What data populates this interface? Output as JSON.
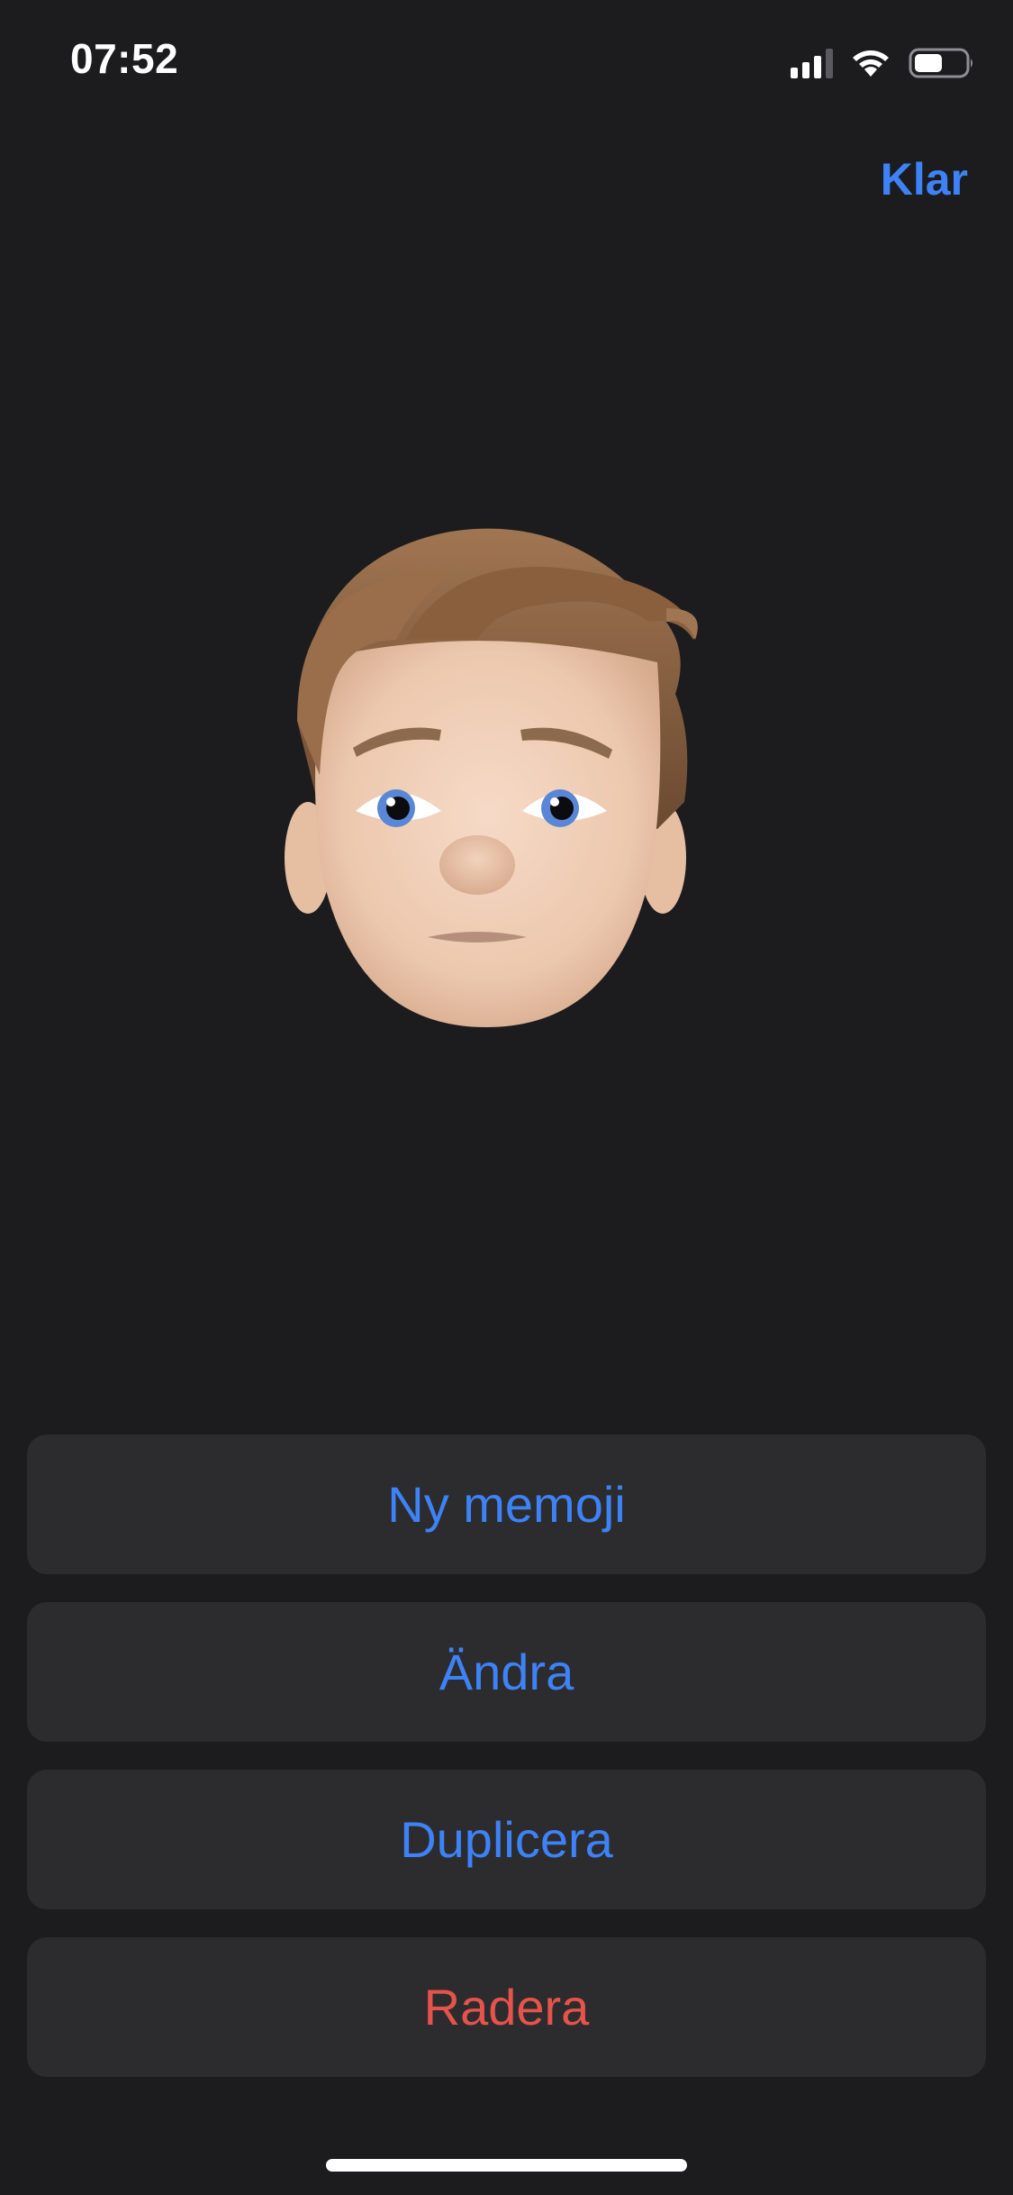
{
  "status_bar": {
    "time": "07:52",
    "icons": [
      "cellular-signal-icon",
      "wifi-icon",
      "battery-icon"
    ]
  },
  "nav": {
    "done_label": "Klar"
  },
  "avatar": {
    "icon": "memoji-avatar"
  },
  "actions": [
    {
      "label": "Ny memoji",
      "color": "#3d82f6"
    },
    {
      "label": "Ändra",
      "color": "#3d82f6"
    },
    {
      "label": "Duplicera",
      "color": "#3d82f6"
    },
    {
      "label": "Radera",
      "color": "#e5534b"
    }
  ],
  "colors": {
    "background": "#1c1c1e",
    "button_background": "#2c2c2e",
    "accent": "#3d82f6",
    "destructive": "#e5534b"
  }
}
